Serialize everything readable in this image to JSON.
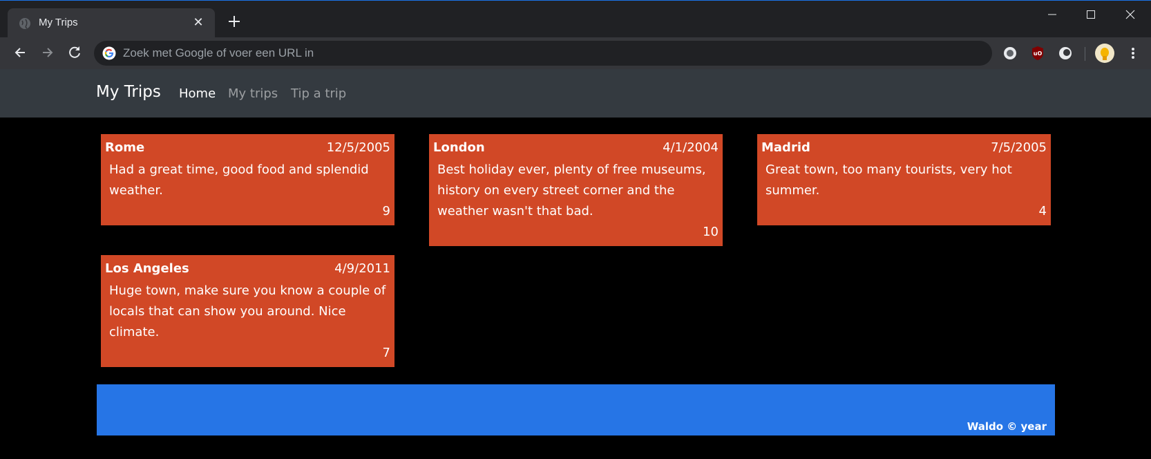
{
  "browser": {
    "tab_title": "My Trips",
    "tab_close_glyph": "✕",
    "address_placeholder": "Zoek met Google of voer een URL in"
  },
  "site": {
    "brand": "My Trips",
    "nav": [
      {
        "label": "Home",
        "active": true
      },
      {
        "label": "My trips",
        "active": false
      },
      {
        "label": "Tip a trip",
        "active": false
      }
    ]
  },
  "trips": [
    {
      "city": "Rome",
      "date": "12/5/2005",
      "text": "Had a great time, good food and splendid weather.",
      "rating": "9"
    },
    {
      "city": "London",
      "date": "4/1/2004",
      "text": "Best holiday ever, plenty of free museums, history on every street corner and the weather wasn't that bad.",
      "rating": "10"
    },
    {
      "city": "Madrid",
      "date": "7/5/2005",
      "text": "Great town, too many tourists, very hot summer.",
      "rating": "4"
    },
    {
      "city": "Los Angeles",
      "date": "4/9/2011",
      "text": "Huge town, make sure you know a couple of locals that can show you around. Nice climate.",
      "rating": "7"
    }
  ],
  "footer": {
    "text": "Waldo © year"
  },
  "colors": {
    "card": "#d14826",
    "footer": "#2675e6",
    "navbar": "#343a40",
    "page_bg": "#000000"
  },
  "icons": {
    "tab": "globe-icon",
    "new_tab": "plus-icon",
    "back": "arrow-left-icon",
    "forward": "arrow-right-icon",
    "reload": "reload-icon",
    "search_engine": "google-icon",
    "extensions": [
      "extension-circle-icon",
      "ublock-icon",
      "extension-moon-icon"
    ],
    "profile": "avatar-icon",
    "menu": "kebab-menu-icon"
  }
}
